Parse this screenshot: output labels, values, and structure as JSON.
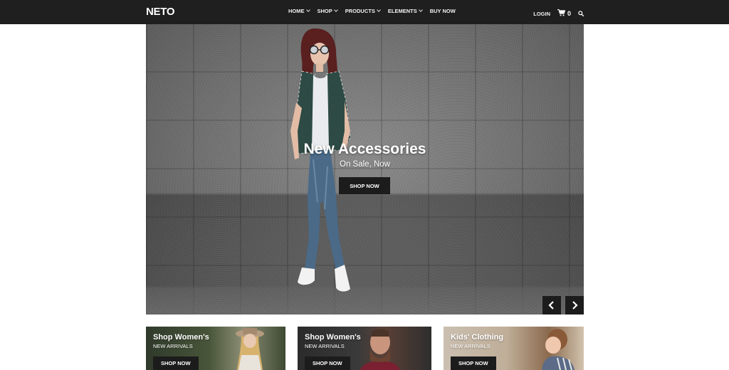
{
  "brand": {
    "logo": "NETO"
  },
  "nav": {
    "items": [
      {
        "label": "HOME",
        "has_dropdown": true
      },
      {
        "label": "SHOP",
        "has_dropdown": true
      },
      {
        "label": "PRODUCTS",
        "has_dropdown": true
      },
      {
        "label": "ELEMENTS",
        "has_dropdown": true
      },
      {
        "label": "BUY NOW",
        "has_dropdown": false
      }
    ],
    "login_label": "LOGIN",
    "cart_count": "0",
    "icons": {
      "cart": "cart-icon",
      "search": "search-icon",
      "dropdown": "chevron-down-icon"
    }
  },
  "hero": {
    "title": "New Accessories",
    "subtitle": "On Sale, Now",
    "button_label": "SHOP NOW",
    "arrows": {
      "prev": "chevron-left-icon",
      "next": "chevron-right-icon"
    }
  },
  "promos": [
    {
      "title": "Shop Women's",
      "subtitle": "NEW ARRIVALS",
      "button_label": "SHOP NOW"
    },
    {
      "title": "Shop Women's",
      "subtitle": "NEW ARRIVALS",
      "button_label": "SHOP NOW"
    },
    {
      "title": "Kids' Clothing",
      "subtitle": "NEW ARRIVALS",
      "button_label": "SHOP NOW"
    }
  ],
  "colors": {
    "header_bg": "#1f1f1f",
    "button_bg": "#1c1c1c",
    "text_light": "#ffffff"
  }
}
